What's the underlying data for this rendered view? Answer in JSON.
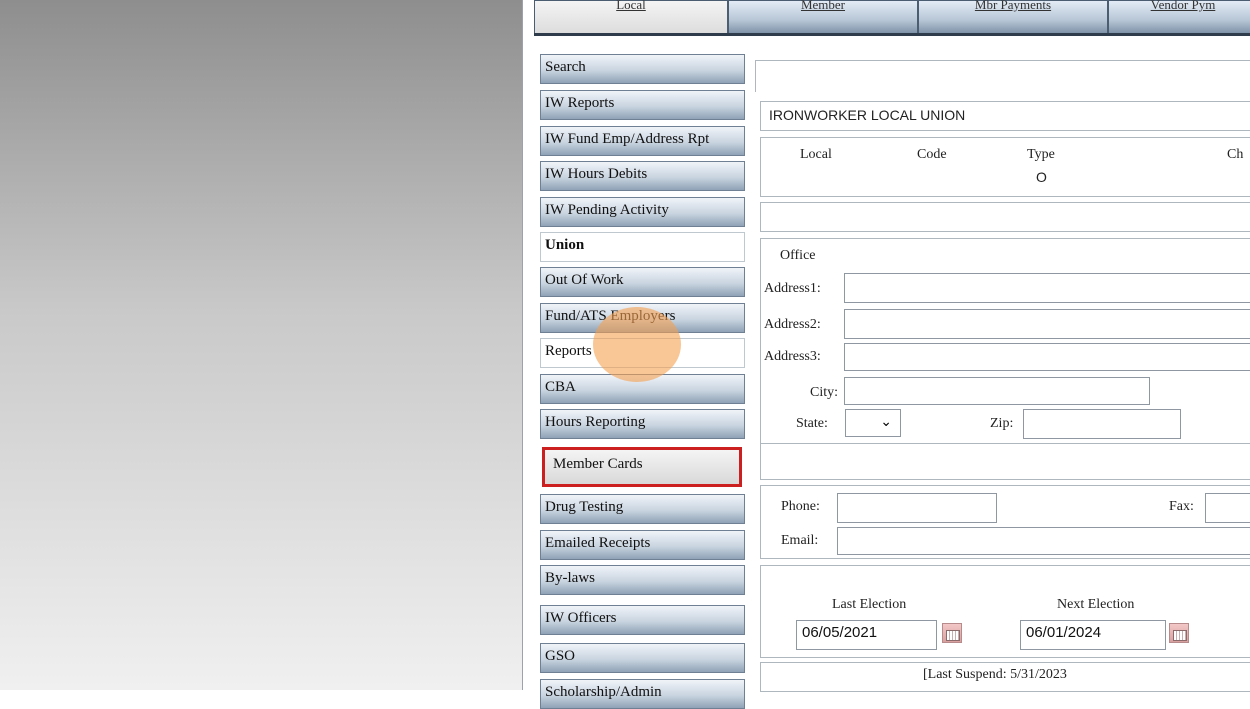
{
  "top_tabs": [
    {
      "label": "Local",
      "active": true
    },
    {
      "label": "Member",
      "active": false
    },
    {
      "label": "Mbr Payments",
      "active": false
    },
    {
      "label": "Vendor Pym",
      "active": false
    }
  ],
  "sidebar": {
    "items": [
      {
        "label": "Search"
      },
      {
        "label": "IW Reports"
      },
      {
        "label": "IW Fund Emp/Address Rpt"
      },
      {
        "label": "IW Hours Debits"
      },
      {
        "label": "IW Pending Activity"
      },
      {
        "label": "Union"
      },
      {
        "label": "Out Of Work"
      },
      {
        "label": "Fund/ATS Employers"
      },
      {
        "label": "Reports"
      },
      {
        "label": "CBA"
      },
      {
        "label": "Hours Reporting"
      },
      {
        "label": "Member Cards"
      },
      {
        "label": "Drug Testing"
      },
      {
        "label": "Emailed Receipts"
      },
      {
        "label": "By-laws"
      },
      {
        "label": "IW Officers"
      },
      {
        "label": "GSO"
      },
      {
        "label": "Scholarship/Admin"
      }
    ]
  },
  "union": {
    "name": "IRONWORKER LOCAL UNION",
    "columns": {
      "local": "Local",
      "code": "Code",
      "type": "Type",
      "ch": "Ch"
    },
    "type_value": "O",
    "office_label": "Office",
    "address1_label": "Address1:",
    "address2_label": "Address2:",
    "address3_label": "Address3:",
    "city_label": "City:",
    "state_label": "State:",
    "zip_label": "Zip:",
    "phone_label": "Phone:",
    "fax_label": "Fax:",
    "email_label": "Email:",
    "last_election_label": "Last Election",
    "next_election_label": "Next Election",
    "last_election_value": "06/05/2021",
    "next_election_value": "06/01/2024",
    "suspend_text": "[Last Suspend: 5/31/2023"
  }
}
